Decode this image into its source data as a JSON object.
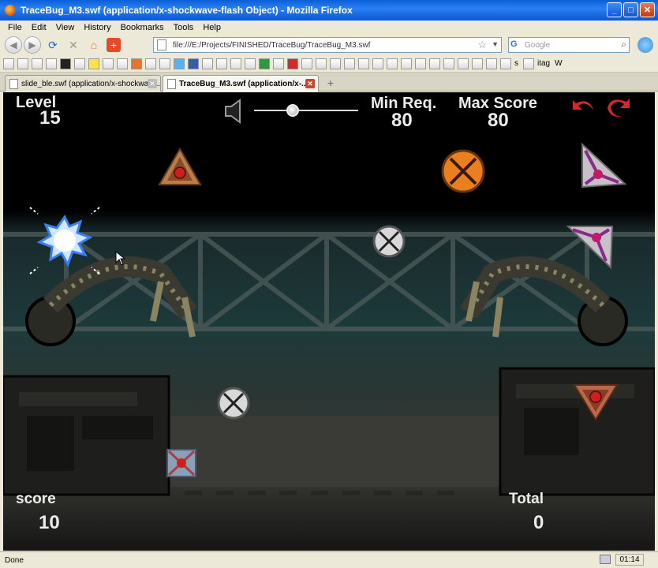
{
  "window": {
    "title": "TraceBug_M3.swf (application/x-shockwave-flash Object) - Mozilla Firefox",
    "controls": {
      "minimize": "_",
      "maximize": "□",
      "close": "✕"
    }
  },
  "menu": [
    "File",
    "Edit",
    "View",
    "History",
    "Bookmarks",
    "Tools",
    "Help"
  ],
  "nav": {
    "url": "file:///E:/Projects/FINISHED/TraceBug/TraceBug_M3.swf",
    "search_placeholder": "Google"
  },
  "bookmarks": {
    "labels": [
      "s",
      "itag",
      "W"
    ]
  },
  "tabs": [
    {
      "label": "slide_ble.swf (application/x-shockwave...",
      "active": false
    },
    {
      "label": "TraceBug_M3.swf (application/x-...",
      "active": true
    }
  ],
  "game": {
    "level_label": "Level",
    "level_value": "15",
    "min_req_label": "Min Req.",
    "min_req_value": "80",
    "max_score_label": "Max Score",
    "max_score_value": "80",
    "score_label": "score",
    "score_value": "10",
    "total_label": "Total",
    "total_value": "0",
    "volume_level": 0.35,
    "colors": {
      "hud_text": "#ececec",
      "undo_icons": "#d4272a",
      "node_orange": "#ea7f1f",
      "node_red": "#d01e1e"
    }
  },
  "status": {
    "text": "Done",
    "clock": "01:14"
  }
}
